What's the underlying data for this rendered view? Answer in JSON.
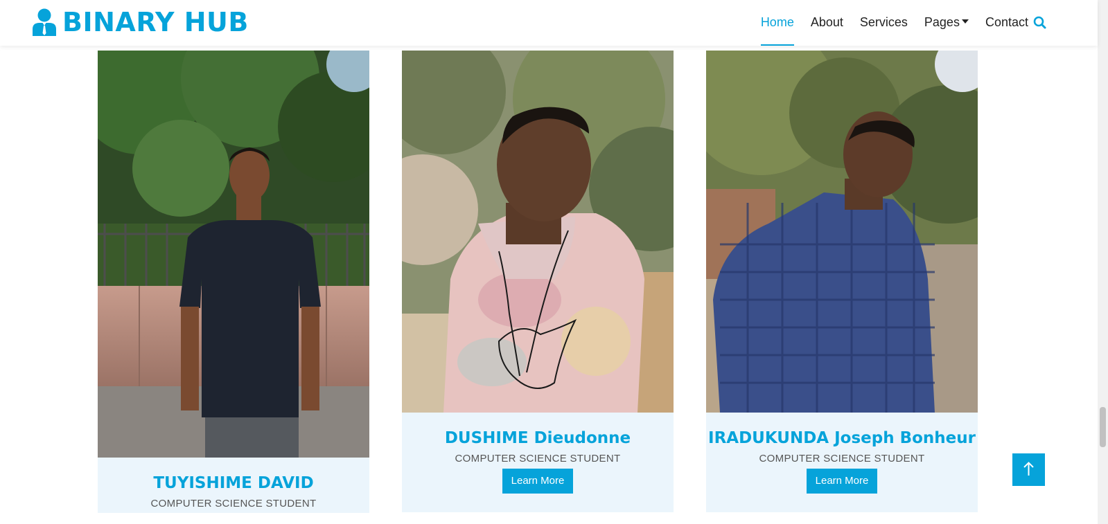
{
  "brand": {
    "name": "BINARY HUB"
  },
  "nav": {
    "home": "Home",
    "about": "About",
    "services": "Services",
    "pages": "Pages",
    "contact": "Contact"
  },
  "team": [
    {
      "name": "TUYISHIME DAVID",
      "role": "COMPUTER SCIENCE STUDENT"
    },
    {
      "name": "DUSHIME Dieudonne",
      "role": "COMPUTER SCIENCE STUDENT",
      "button": "Learn More"
    },
    {
      "name": "IRADUKUNDA Joseph Bonheur",
      "role": "COMPUTER SCIENCE STUDENT",
      "button": "Learn More"
    }
  ],
  "colors": {
    "accent": "#06a3da",
    "card_bg": "#ebf5fc"
  },
  "icons": [
    "user-tie-icon",
    "search-icon",
    "arrow-up-icon",
    "chevron-down-icon"
  ]
}
